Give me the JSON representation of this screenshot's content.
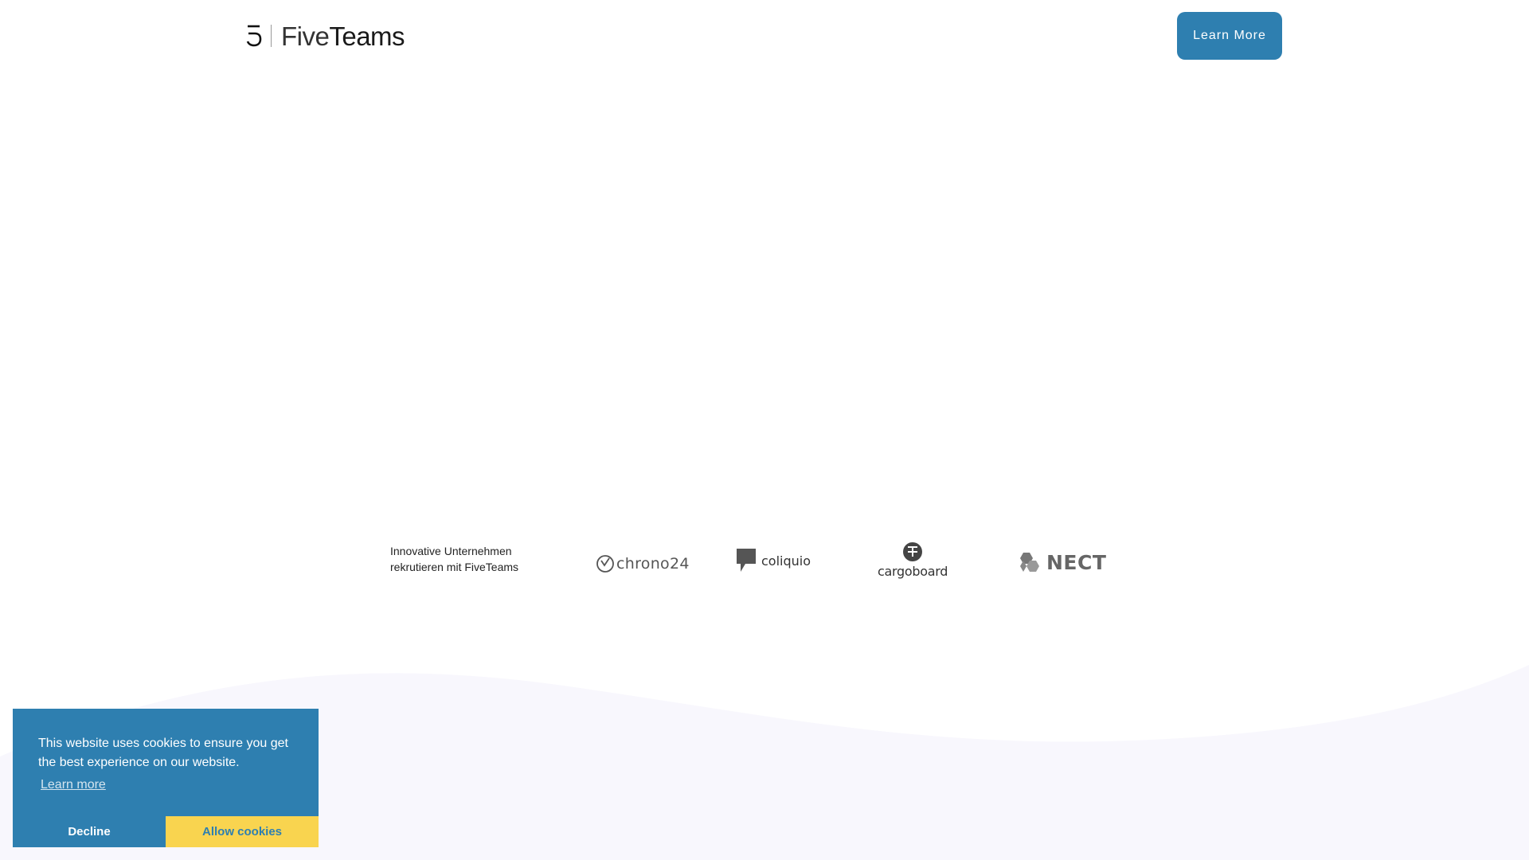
{
  "header": {
    "logo_five": "Five",
    "logo_teams": "Teams",
    "cta_label": "Learn More"
  },
  "clients": {
    "tagline": "Innovative Unternehmen rekrutieren mit FiveTeams",
    "logos": [
      {
        "name": "chrono24",
        "text": "chrono24"
      },
      {
        "name": "coliquio",
        "text": "coliquio"
      },
      {
        "name": "cargoboard",
        "text": "cargoboard"
      },
      {
        "name": "NECT",
        "text": "NECT"
      }
    ]
  },
  "cookie_banner": {
    "message": "This website uses cookies to ensure you get the best experience on our website.",
    "learn_more": "Learn more",
    "decline": "Decline",
    "allow": "Allow cookies"
  },
  "colors": {
    "primary": "#2e7fb0",
    "accent": "#f9d44f",
    "wave": "#f8f7fd",
    "text": "#222222"
  },
  "icons": [
    "fiveteams-logo-icon",
    "chrono24-clock-icon",
    "coliquio-bubble-icon",
    "cargoboard-cube-icon",
    "nect-logo-icon"
  ]
}
